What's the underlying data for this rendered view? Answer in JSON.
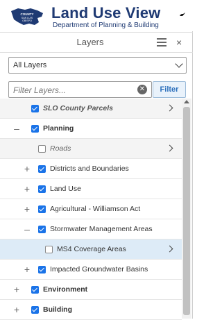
{
  "brand": {
    "title": "Land Use View",
    "subtitle": "Department of Planning & Building",
    "logo_text": "COUNTY OF SAN LUIS OBISPO",
    "accent_color": "#1f3a73"
  },
  "panel": {
    "title": "Layers",
    "menu_icon": "hamburger-icon",
    "close_icon": "close-icon",
    "close_glyph": "×"
  },
  "layer_select": {
    "value": "All Layers"
  },
  "filter": {
    "placeholder": "Filter Layers...",
    "clear_glyph": "✕",
    "button_label": "Filter"
  },
  "tree": {
    "items": [
      {
        "label": "SLO County Parcels",
        "checked": true,
        "expander": "",
        "has_arrow": true
      },
      {
        "label": "Planning",
        "checked": true,
        "expander": "–",
        "has_arrow": false
      },
      {
        "label": "Roads",
        "checked": false,
        "expander": "",
        "has_arrow": true
      },
      {
        "label": "Districts and Boundaries",
        "checked": true,
        "expander": "+",
        "has_arrow": false
      },
      {
        "label": "Land Use",
        "checked": true,
        "expander": "+",
        "has_arrow": false
      },
      {
        "label": "Agricultural - Williamson Act",
        "checked": true,
        "expander": "+",
        "has_arrow": false
      },
      {
        "label": "Stormwater Management Areas",
        "checked": true,
        "expander": "–",
        "has_arrow": false
      },
      {
        "label": "MS4 Coverage Areas",
        "checked": false,
        "expander": "",
        "has_arrow": true
      },
      {
        "label": "Impacted Groundwater Basins",
        "checked": true,
        "expander": "+",
        "has_arrow": false
      },
      {
        "label": "Environment",
        "checked": true,
        "expander": "+",
        "has_arrow": false
      },
      {
        "label": "Building",
        "checked": true,
        "expander": "+",
        "has_arrow": false
      }
    ]
  },
  "colors": {
    "checkbox_on": "#1a73e8",
    "selected_row": "#ddebf7",
    "filter_button_text": "#2a6ebb"
  }
}
